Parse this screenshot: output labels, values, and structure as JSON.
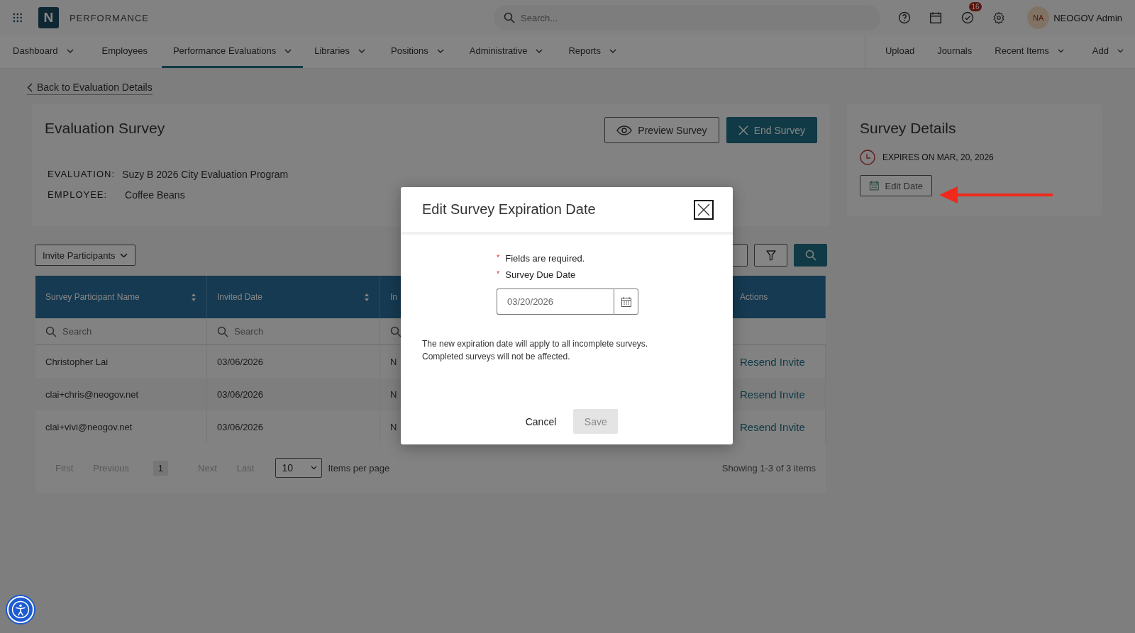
{
  "app": {
    "logo": "N",
    "title": "PERFORMANCE",
    "search_placeholder": "Search...",
    "notification_count": "16",
    "user": {
      "initials": "NA",
      "name": "NEOGOV Admin"
    }
  },
  "nav": {
    "items": [
      {
        "label": "Dashboard",
        "dropdown": true,
        "selected": false
      },
      {
        "label": "Employees",
        "dropdown": false,
        "selected": false
      },
      {
        "label": "Performance Evaluations",
        "dropdown": true,
        "selected": true
      },
      {
        "label": "Libraries",
        "dropdown": true,
        "selected": false
      },
      {
        "label": "Positions",
        "dropdown": true,
        "selected": false
      },
      {
        "label": "Administrative",
        "dropdown": true,
        "selected": false
      },
      {
        "label": "Reports",
        "dropdown": true,
        "selected": false
      }
    ],
    "right_items": [
      {
        "label": "Upload",
        "dropdown": false
      },
      {
        "label": "Journals",
        "dropdown": false
      },
      {
        "label": "Recent Items",
        "dropdown": true
      },
      {
        "label": "Add",
        "dropdown": true
      }
    ]
  },
  "back_link": "Back to Evaluation Details",
  "survey": {
    "title": "Evaluation Survey",
    "buttons": [
      {
        "label": "Preview Survey",
        "kind": "outline"
      },
      {
        "label": "End Survey",
        "kind": "primary"
      }
    ],
    "fields": [
      {
        "label": "EVALUATION:",
        "value": "Suzy B 2026 City Evaluation Program"
      },
      {
        "label": "EMPLOYEE:",
        "value": "Coffee Beans"
      }
    ]
  },
  "details": {
    "title": "Survey Details",
    "expires": "EXPIRES ON MAR, 20, 2026",
    "edit_button": "Edit Date"
  },
  "invite_button": "Invite Participants",
  "table": {
    "columns": [
      {
        "label": "Survey Participant Name",
        "sortable": true,
        "searchable": true,
        "search_placeholder": "Search"
      },
      {
        "label": "Invited Date",
        "sortable": true,
        "searchable": true,
        "search_placeholder": "Search"
      },
      {
        "label": "In",
        "sortable": false,
        "searchable": true
      },
      {
        "label": "Actions",
        "sortable": false,
        "searchable": false
      }
    ],
    "rows": [
      {
        "cells": [
          "Christopher Lai",
          "03/06/2026",
          "N"
        ],
        "action": "Resend Invite"
      },
      {
        "cells": [
          "clai+chris@neogov.net",
          "03/06/2026",
          "N"
        ],
        "action": "Resend Invite"
      },
      {
        "cells": [
          "clai+vivi@neogov.net",
          "03/06/2026",
          "N"
        ],
        "action": "Resend Invite"
      }
    ]
  },
  "pagination": {
    "controls": [
      {
        "kind": "nav",
        "label": "First",
        "disabled": true
      },
      {
        "kind": "nav",
        "label": "Previous",
        "disabled": true
      },
      {
        "kind": "page",
        "label": "1",
        "selected": true
      },
      {
        "kind": "nav",
        "label": "Next",
        "disabled": true
      },
      {
        "kind": "nav",
        "label": "Last",
        "disabled": true
      }
    ],
    "page_size": "10",
    "page_size_label": "Items per page",
    "summary": "Showing 1-3 of 3 items"
  },
  "modal": {
    "title": "Edit Survey Expiration Date",
    "required_mark": "*",
    "required_note": "Fields are required.",
    "field_label": "Survey Due Date",
    "field_value": "03/20/2026",
    "message": [
      "The new expiration date will apply to all incomplete surveys.",
      "Completed surveys will not be affected."
    ],
    "buttons": [
      {
        "label": "Cancel",
        "kind": "link",
        "disabled": false
      },
      {
        "label": "Save",
        "kind": "primary",
        "disabled": true
      }
    ]
  }
}
